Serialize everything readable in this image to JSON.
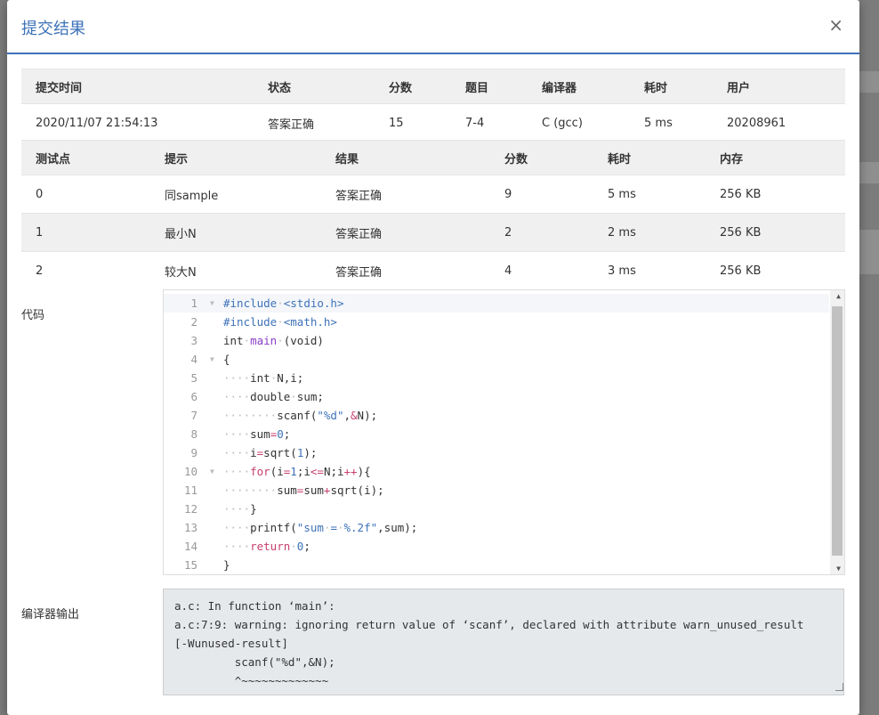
{
  "modal": {
    "title": "提交结果",
    "close_label": "×"
  },
  "summary": {
    "headers": [
      "提交时间",
      "状态",
      "分数",
      "题目",
      "编译器",
      "耗时",
      "用户"
    ],
    "row": {
      "time": "2020/11/07 21:54:13",
      "status": "答案正确",
      "score": "15",
      "problem": "7-4",
      "compiler": "C (gcc)",
      "duration": "5 ms",
      "user": "20208961"
    }
  },
  "tests": {
    "headers": [
      "测试点",
      "提示",
      "结果",
      "分数",
      "耗时",
      "内存"
    ],
    "rows": [
      {
        "id": "0",
        "hint": "同sample",
        "result": "答案正确",
        "score": "9",
        "time": "5 ms",
        "memory": "256 KB"
      },
      {
        "id": "1",
        "hint": "最小N",
        "result": "答案正确",
        "score": "2",
        "time": "2 ms",
        "memory": "256 KB"
      },
      {
        "id": "2",
        "hint": "较大N",
        "result": "答案正确",
        "score": "4",
        "time": "3 ms",
        "memory": "256 KB"
      }
    ]
  },
  "code": {
    "label": "代码",
    "line_numbers": [
      "1",
      "2",
      "3",
      "4",
      "5",
      "6",
      "7",
      "8",
      "9",
      "10",
      "11",
      "12",
      "13",
      "14",
      "15"
    ]
  },
  "compiler_output": {
    "label": "编译器输出",
    "text": "a.c: In function ‘main’:\na.c:7:9: warning: ignoring return value of ‘scanf’, declared with attribute warn_unused_result\n[-Wunused-result]\n         scanf(\"%d\",&N);\n         ^~~~~~~~~~~~~~"
  },
  "colors": {
    "accent": "#3d72b8",
    "success": "#e03b3b",
    "header_bg": "#f0f0f0"
  }
}
